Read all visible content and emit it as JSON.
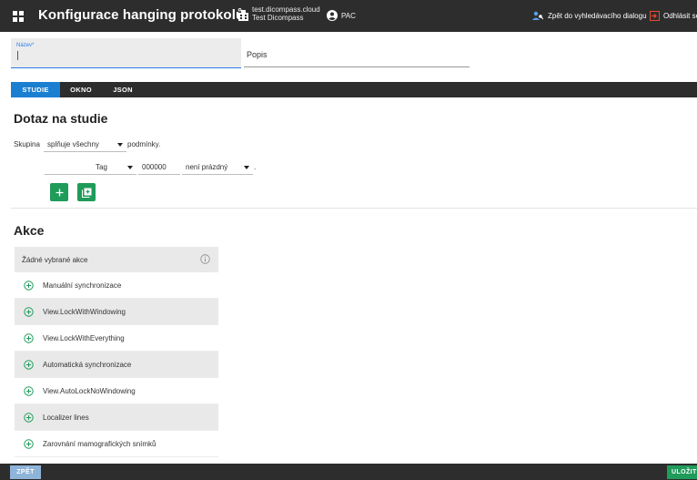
{
  "header": {
    "title": "Konfigurace hanging protokolů",
    "tenant_host": "test.dicompass.cloud",
    "tenant_name": "Test Dicompass",
    "user": "PAC",
    "back_to_search": "Zpět do vyhledávacího dialogu",
    "logout": "Odhlásit se"
  },
  "form": {
    "name_label": "Název*",
    "name_value": "",
    "description_placeholder": "Popis"
  },
  "tabs": [
    {
      "label": "STUDIE",
      "active": true
    },
    {
      "label": "OKNO",
      "active": false
    },
    {
      "label": "JSON",
      "active": false
    }
  ],
  "study_query": {
    "title": "Dotaz na studie",
    "group_label": "Skupina",
    "match_select": "splňuje všechny",
    "conditions_label": "podmínky.",
    "condition": {
      "field_select": "Tag",
      "tag_value": "000000",
      "operator_select": "není prázdný",
      "suffix": "."
    }
  },
  "actions": {
    "title": "Akce",
    "header": "Žádné vybrané akce",
    "items": [
      "Manuální synchronizace",
      "View.LockWithWindowing",
      "View.LockWithEverything",
      "Automatická synchronizace",
      "View.AutoLockNoWindowing",
      "Localizer lines",
      "Zarovnání mamografických snímků"
    ]
  },
  "footer": {
    "back": "ZPĚT",
    "save": "ULOŽIT"
  },
  "colors": {
    "topbar": "#2d2d2d",
    "active_tab": "#1a7fd1",
    "accent_green": "#1f9b5a",
    "logout_icon": "#e54b2e",
    "link_blue": "#2b7de9"
  }
}
